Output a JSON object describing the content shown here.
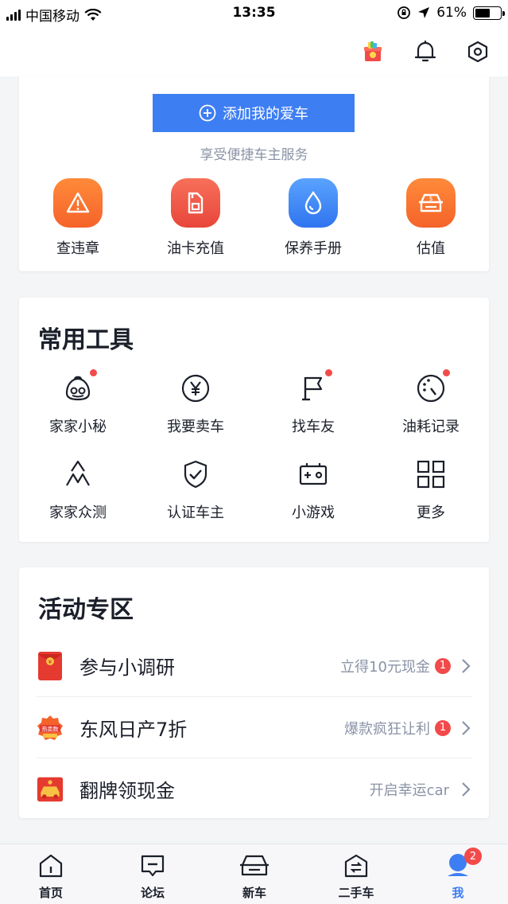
{
  "status_bar": {
    "carrier": "中国移动",
    "time": "13:35",
    "battery": "61%",
    "battery_level": 0.61
  },
  "top_bar": {
    "icons": [
      "gift-icon",
      "bell-icon",
      "settings-icon"
    ]
  },
  "car_card": {
    "add_car_label": "添加我的爱车",
    "hint": "享受便捷车主服务",
    "quick_actions": [
      {
        "label": "查违章",
        "icon": "warning-icon",
        "color": "#f77a2c"
      },
      {
        "label": "油卡充值",
        "icon": "fuel-card-icon",
        "color": "#f0523f"
      },
      {
        "label": "保养手册",
        "icon": "drop-icon",
        "color": "#3e8af3"
      },
      {
        "label": "估值",
        "icon": "valuation-icon",
        "color": "#f77a2c"
      }
    ]
  },
  "tools": {
    "title": "常用工具",
    "items": [
      {
        "label": "家家小秘",
        "icon": "assistant-icon",
        "dot": true
      },
      {
        "label": "我要卖车",
        "icon": "yen-icon",
        "dot": false
      },
      {
        "label": "找车友",
        "icon": "flag-icon",
        "dot": true
      },
      {
        "label": "油耗记录",
        "icon": "gauge-icon",
        "dot": true
      },
      {
        "label": "家家众测",
        "icon": "mountain-icon",
        "dot": false
      },
      {
        "label": "认证车主",
        "icon": "shield-check-icon",
        "dot": false
      },
      {
        "label": "小游戏",
        "icon": "game-icon",
        "dot": false
      },
      {
        "label": "更多",
        "icon": "grid-icon",
        "dot": false
      }
    ]
  },
  "activities": {
    "title": "活动专区",
    "items": [
      {
        "title": "参与小调研",
        "sub": "立得10元现金",
        "badge": "1",
        "icon": "red-envelope-icon"
      },
      {
        "title": "东风日产7折",
        "sub": "爆款疯狂让利",
        "badge": "1",
        "icon": "hot-sale-icon"
      },
      {
        "title": "翻牌领现金",
        "sub": "开启幸运car",
        "badge": "",
        "icon": "flip-card-icon"
      }
    ]
  },
  "hot_sale_text": "热卖款",
  "tab_bar": {
    "tabs": [
      {
        "label": "首页",
        "icon": "home-icon"
      },
      {
        "label": "论坛",
        "icon": "forum-icon"
      },
      {
        "label": "新车",
        "icon": "new-car-icon"
      },
      {
        "label": "二手车",
        "icon": "used-car-icon"
      },
      {
        "label": "我",
        "icon": "profile-icon",
        "badge": "2",
        "active": true
      }
    ]
  },
  "colors": {
    "accent": "#3e7ef3",
    "badge": "#f24a4a"
  }
}
